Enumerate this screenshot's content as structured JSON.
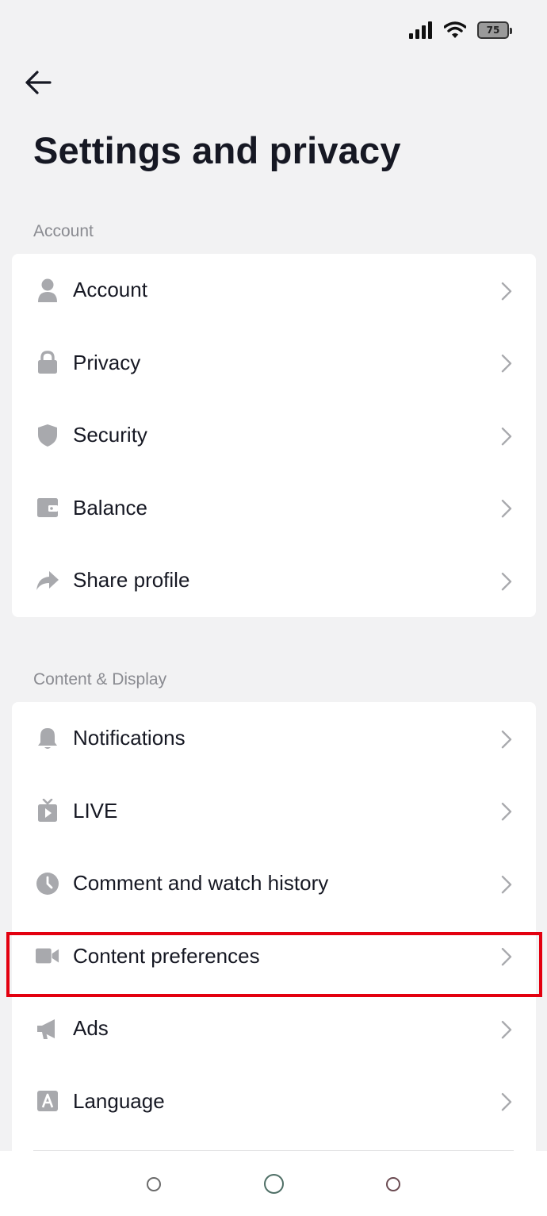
{
  "status_bar": {
    "battery": "75"
  },
  "header": {
    "title": "Settings and privacy"
  },
  "sections": [
    {
      "label": "Account",
      "items": [
        {
          "label": "Account",
          "icon": "person-icon"
        },
        {
          "label": "Privacy",
          "icon": "lock-icon"
        },
        {
          "label": "Security",
          "icon": "shield-icon"
        },
        {
          "label": "Balance",
          "icon": "wallet-icon"
        },
        {
          "label": "Share profile",
          "icon": "share-arrow-icon"
        }
      ]
    },
    {
      "label": "Content & Display",
      "items": [
        {
          "label": "Notifications",
          "icon": "bell-icon"
        },
        {
          "label": "LIVE",
          "icon": "tv-play-icon"
        },
        {
          "label": "Comment and watch history",
          "icon": "clock-icon"
        },
        {
          "label": "Content preferences",
          "icon": "video-camera-icon",
          "highlighted": true
        },
        {
          "label": "Ads",
          "icon": "megaphone-icon"
        },
        {
          "label": "Language",
          "icon": "language-icon"
        }
      ]
    }
  ],
  "colors": {
    "highlight": "#e3000f",
    "icon": "#a8a9ad",
    "background": "#f2f2f3"
  }
}
